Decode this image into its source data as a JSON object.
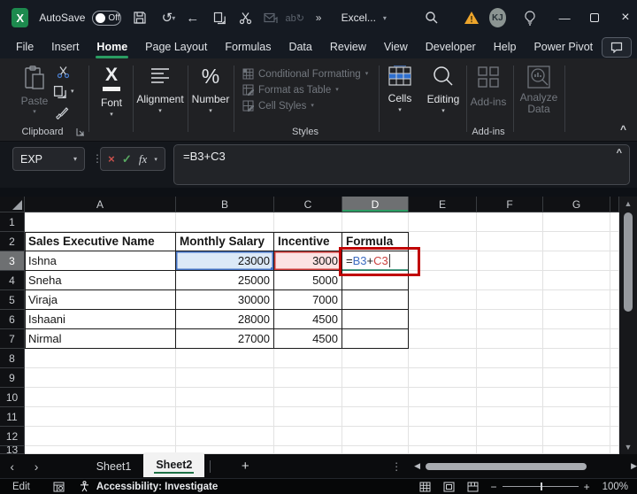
{
  "icons": {
    "chevron_down": "▾",
    "collapse_up": "^",
    "overflow": "»",
    "dots_v": "⋮",
    "close": "×",
    "minimize": "—",
    "arrow_left": "←",
    "undo": "↺",
    "replace_ab": "ab↻",
    "tri_up": "▲",
    "tri_down": "▼",
    "tri_left": "◀",
    "tri_right": "▶",
    "nav_left": "‹",
    "nav_right": "›",
    "plus": "+",
    "minus": "−",
    "cancel": "×",
    "check": "✓",
    "fx": "fx",
    "logo_x": "X"
  },
  "titlebar": {
    "autosave_label": "AutoSave",
    "autosave_state": "Off",
    "app_title": "Excel...",
    "avatar_initials": "KJ"
  },
  "ribbon_tabs": [
    {
      "label": "File"
    },
    {
      "label": "Insert"
    },
    {
      "label": "Home",
      "active": true
    },
    {
      "label": "Page Layout"
    },
    {
      "label": "Formulas"
    },
    {
      "label": "Data"
    },
    {
      "label": "Review"
    },
    {
      "label": "View"
    },
    {
      "label": "Developer"
    },
    {
      "label": "Help"
    },
    {
      "label": "Power Pivot"
    }
  ],
  "ribbon": {
    "paste_label": "Paste",
    "clipboard_group": "Clipboard",
    "font_label": "Font",
    "alignment_label": "Alignment",
    "number_label": "Number",
    "styles_items": [
      "Conditional Formatting",
      "Format as Table",
      "Cell Styles"
    ],
    "styles_group": "Styles",
    "cells_label": "Cells",
    "editing_label": "Editing",
    "addins_label": "Add-ins",
    "analyze_label_1": "Analyze",
    "analyze_label_2": "Data",
    "addins_group": "Add-ins"
  },
  "formula_bar": {
    "name_box": "EXP",
    "formula": "=B3+C3",
    "formula_parts": [
      {
        "t": "=",
        "c": "k"
      },
      {
        "t": "B3",
        "c": "blue"
      },
      {
        "t": "+",
        "c": "k"
      },
      {
        "t": "C3",
        "c": "red"
      }
    ]
  },
  "grid": {
    "columns": [
      "A",
      "B",
      "C",
      "D",
      "E",
      "F",
      "G"
    ],
    "selected_column": "D",
    "selected_row": 3,
    "row_count": 13,
    "edit_cell": "D3",
    "cells": {
      "A2": {
        "text": "Sales Executive Name",
        "style": "hdr"
      },
      "B2": {
        "text": "Monthly Salary",
        "style": "hdr"
      },
      "C2": {
        "text": "Incentive",
        "style": "hdr"
      },
      "D2": {
        "text": "Formula",
        "style": "hdr"
      },
      "A3": {
        "text": "Ishna"
      },
      "B3": {
        "text": "23000",
        "style": "num ref-b"
      },
      "C3": {
        "text": "3000",
        "style": "num ref-r"
      },
      "A4": {
        "text": "Sneha"
      },
      "B4": {
        "text": "25000",
        "style": "num"
      },
      "C4": {
        "text": "5000",
        "style": "num"
      },
      "A5": {
        "text": "Viraja"
      },
      "B5": {
        "text": "30000",
        "style": "num"
      },
      "C5": {
        "text": "7000",
        "style": "num"
      },
      "A6": {
        "text": "Ishaani"
      },
      "B6": {
        "text": "28000",
        "style": "num"
      },
      "C6": {
        "text": "4500",
        "style": "num"
      },
      "A7": {
        "text": "Nirmal"
      },
      "B7": {
        "text": "27000",
        "style": "num"
      },
      "C7": {
        "text": "4500",
        "style": "num"
      }
    },
    "table_range": {
      "first_row": 2,
      "last_row": 7,
      "first_col": "A",
      "last_col": "D"
    }
  },
  "sheet_tabs": {
    "tabs": [
      {
        "label": "Sheet1"
      },
      {
        "label": "Sheet2",
        "active": true
      }
    ]
  },
  "status_bar": {
    "mode": "Edit",
    "accessibility": "Accessibility: Investigate",
    "zoom": "100%"
  }
}
